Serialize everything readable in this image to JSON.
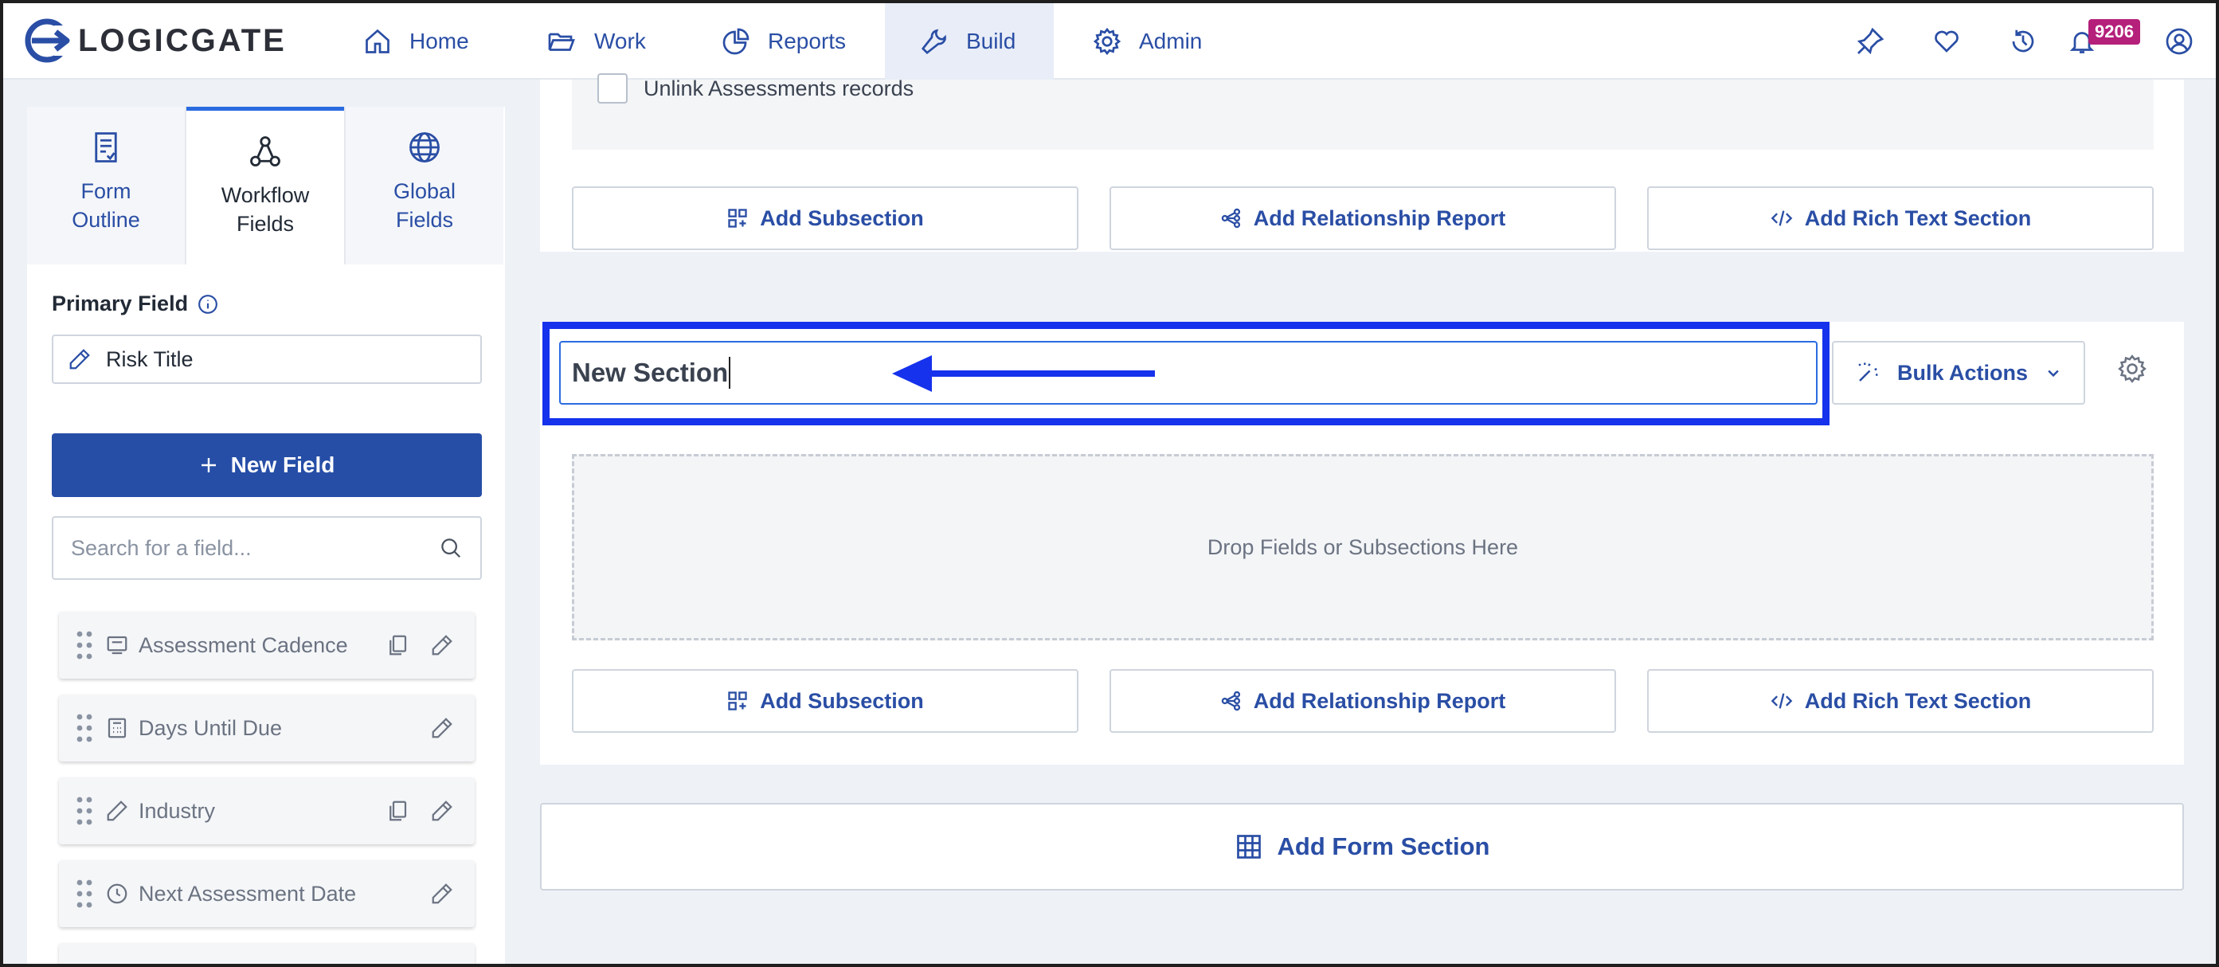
{
  "app": {
    "logo_text": "LOGICGATE"
  },
  "nav": {
    "items": [
      {
        "label": "Home",
        "icon": "home-icon"
      },
      {
        "label": "Work",
        "icon": "folder-icon"
      },
      {
        "label": "Reports",
        "icon": "pie-chart-icon"
      },
      {
        "label": "Build",
        "icon": "wrench-icon",
        "active": true
      },
      {
        "label": "Admin",
        "icon": "gear-icon"
      }
    ],
    "right_icons": [
      "pin-icon",
      "heart-icon",
      "history-icon",
      "bell-icon",
      "user-icon"
    ],
    "notification_count": "9206"
  },
  "sidebar": {
    "tabs": [
      {
        "label_line1": "Form",
        "label_line2": "Outline",
        "icon": "form-outline-icon"
      },
      {
        "label_line1": "Workflow",
        "label_line2": "Fields",
        "icon": "workflow-icon",
        "active": true
      },
      {
        "label_line1": "Global",
        "label_line2": "Fields",
        "icon": "globe-icon"
      }
    ],
    "primary_field_label": "Primary Field",
    "primary_field_value": "Risk Title",
    "new_field_label": "New Field",
    "search_placeholder": "Search for a field...",
    "fields": [
      {
        "name": "Assessment Cadence",
        "icon": "card-icon",
        "copy": true
      },
      {
        "name": "Days Until Due",
        "icon": "calculator-icon",
        "copy": false
      },
      {
        "name": "Industry",
        "icon": "pencil-icon",
        "copy": true
      },
      {
        "name": "Next Assessment Date",
        "icon": "clock-icon",
        "copy": false
      }
    ]
  },
  "main": {
    "checkbox_label": "Unlink Assessments records",
    "add_subsection": "Add Subsection",
    "add_relationship_report": "Add Relationship Report",
    "add_rich_text_section": "Add Rich Text Section",
    "section_title_value": "New Section",
    "bulk_actions": "Bulk Actions",
    "drop_zone_text": "Drop Fields or Subsections Here",
    "add_form_section": "Add Form Section"
  },
  "colors": {
    "accent": "#2a4ea5",
    "primary_button": "#264ea7",
    "highlight": "#1632ec",
    "badge": "#b4207a"
  }
}
